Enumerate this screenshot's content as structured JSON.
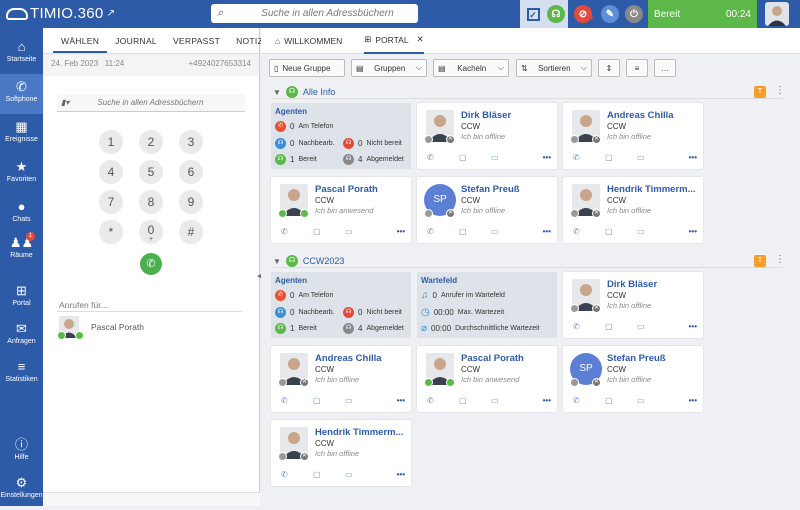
{
  "topbar": {
    "brand": "TIMIO.360",
    "search_placeholder": "Suche in allen Adressbüchern",
    "status_label": "Bereit",
    "timer": "00:24"
  },
  "sidenav": {
    "items": [
      {
        "label": "Startseite",
        "icon": "home-icon"
      },
      {
        "label": "Softphone",
        "icon": "phone-icon"
      },
      {
        "label": "Ereignisse",
        "icon": "calendar-icon"
      },
      {
        "label": "Favoriten",
        "icon": "star-icon"
      },
      {
        "label": "Chats",
        "icon": "chat-icon"
      },
      {
        "label": "Räume",
        "icon": "rooms-icon",
        "badge": "1"
      },
      {
        "label": "Portal",
        "icon": "grid-icon"
      },
      {
        "label": "Anfragen",
        "icon": "inbox-icon"
      },
      {
        "label": "Statistiken",
        "icon": "stats-icon"
      },
      {
        "label": "Hilfe",
        "icon": "help-icon"
      },
      {
        "label": "Einstellungen",
        "icon": "gear-icon"
      }
    ]
  },
  "softphone": {
    "tabs": [
      "WÄHLEN",
      "JOURNAL",
      "VERPASST",
      "NOTIZEN"
    ],
    "date": "24. Feb 2023",
    "time": "11:24",
    "number": "+4924027653314",
    "search_placeholder": "Suche in allen Adressbüchern",
    "keys": [
      "1",
      "2",
      "3",
      "4",
      "5",
      "6",
      "7",
      "8",
      "9",
      "*",
      "0",
      "#"
    ],
    "zero_sub": "+",
    "call_for_label": "Anrufen für...",
    "call_for_person": "Pascal Porath"
  },
  "main": {
    "tabs": [
      {
        "label": "WILLKOMMEN"
      },
      {
        "label": "PORTAL"
      }
    ],
    "toolbar": {
      "new_group": "Neue Gruppe",
      "groups": "Gruppen",
      "tiles": "Kacheln",
      "sort": "Sortieren"
    },
    "sections": [
      {
        "title": "Alle Info",
        "badge": "T"
      },
      {
        "title": "CCW2023",
        "badge": "T"
      }
    ],
    "agents_title": "Agenten",
    "agents_stats": [
      {
        "value": "0",
        "label": "Am Telefon"
      },
      {
        "value": "0",
        "label": "Nachbearb."
      },
      {
        "value": "0",
        "label": "Nicht bereit"
      },
      {
        "value": "1",
        "label": "Bereit"
      },
      {
        "value": "4",
        "label": "Abgemeldet"
      }
    ],
    "queue_title": "Wartefeld",
    "queue_stats": [
      {
        "value": "0",
        "label": "Anrufer im Wartefeld"
      },
      {
        "value": "00:00",
        "label": "Max. Wartezeit"
      },
      {
        "value": "00:00",
        "label": "Durchschnittliche Wartezeit"
      }
    ],
    "contacts": [
      {
        "name": "Dirk Bläser",
        "company": "CCW",
        "status": "Ich bin offline"
      },
      {
        "name": "Andreas Chilla",
        "company": "CCW",
        "status": "Ich bin offline"
      },
      {
        "name": "Pascal Porath",
        "company": "CCW",
        "status": "Ich bin anwesend"
      },
      {
        "name": "Stefan Preuß",
        "company": "CCW",
        "status": "Ich bin offline",
        "initials": "SP"
      },
      {
        "name": "Hendrik Timmerm...",
        "company": "CCW",
        "status": "Ich bin offline"
      }
    ]
  }
}
